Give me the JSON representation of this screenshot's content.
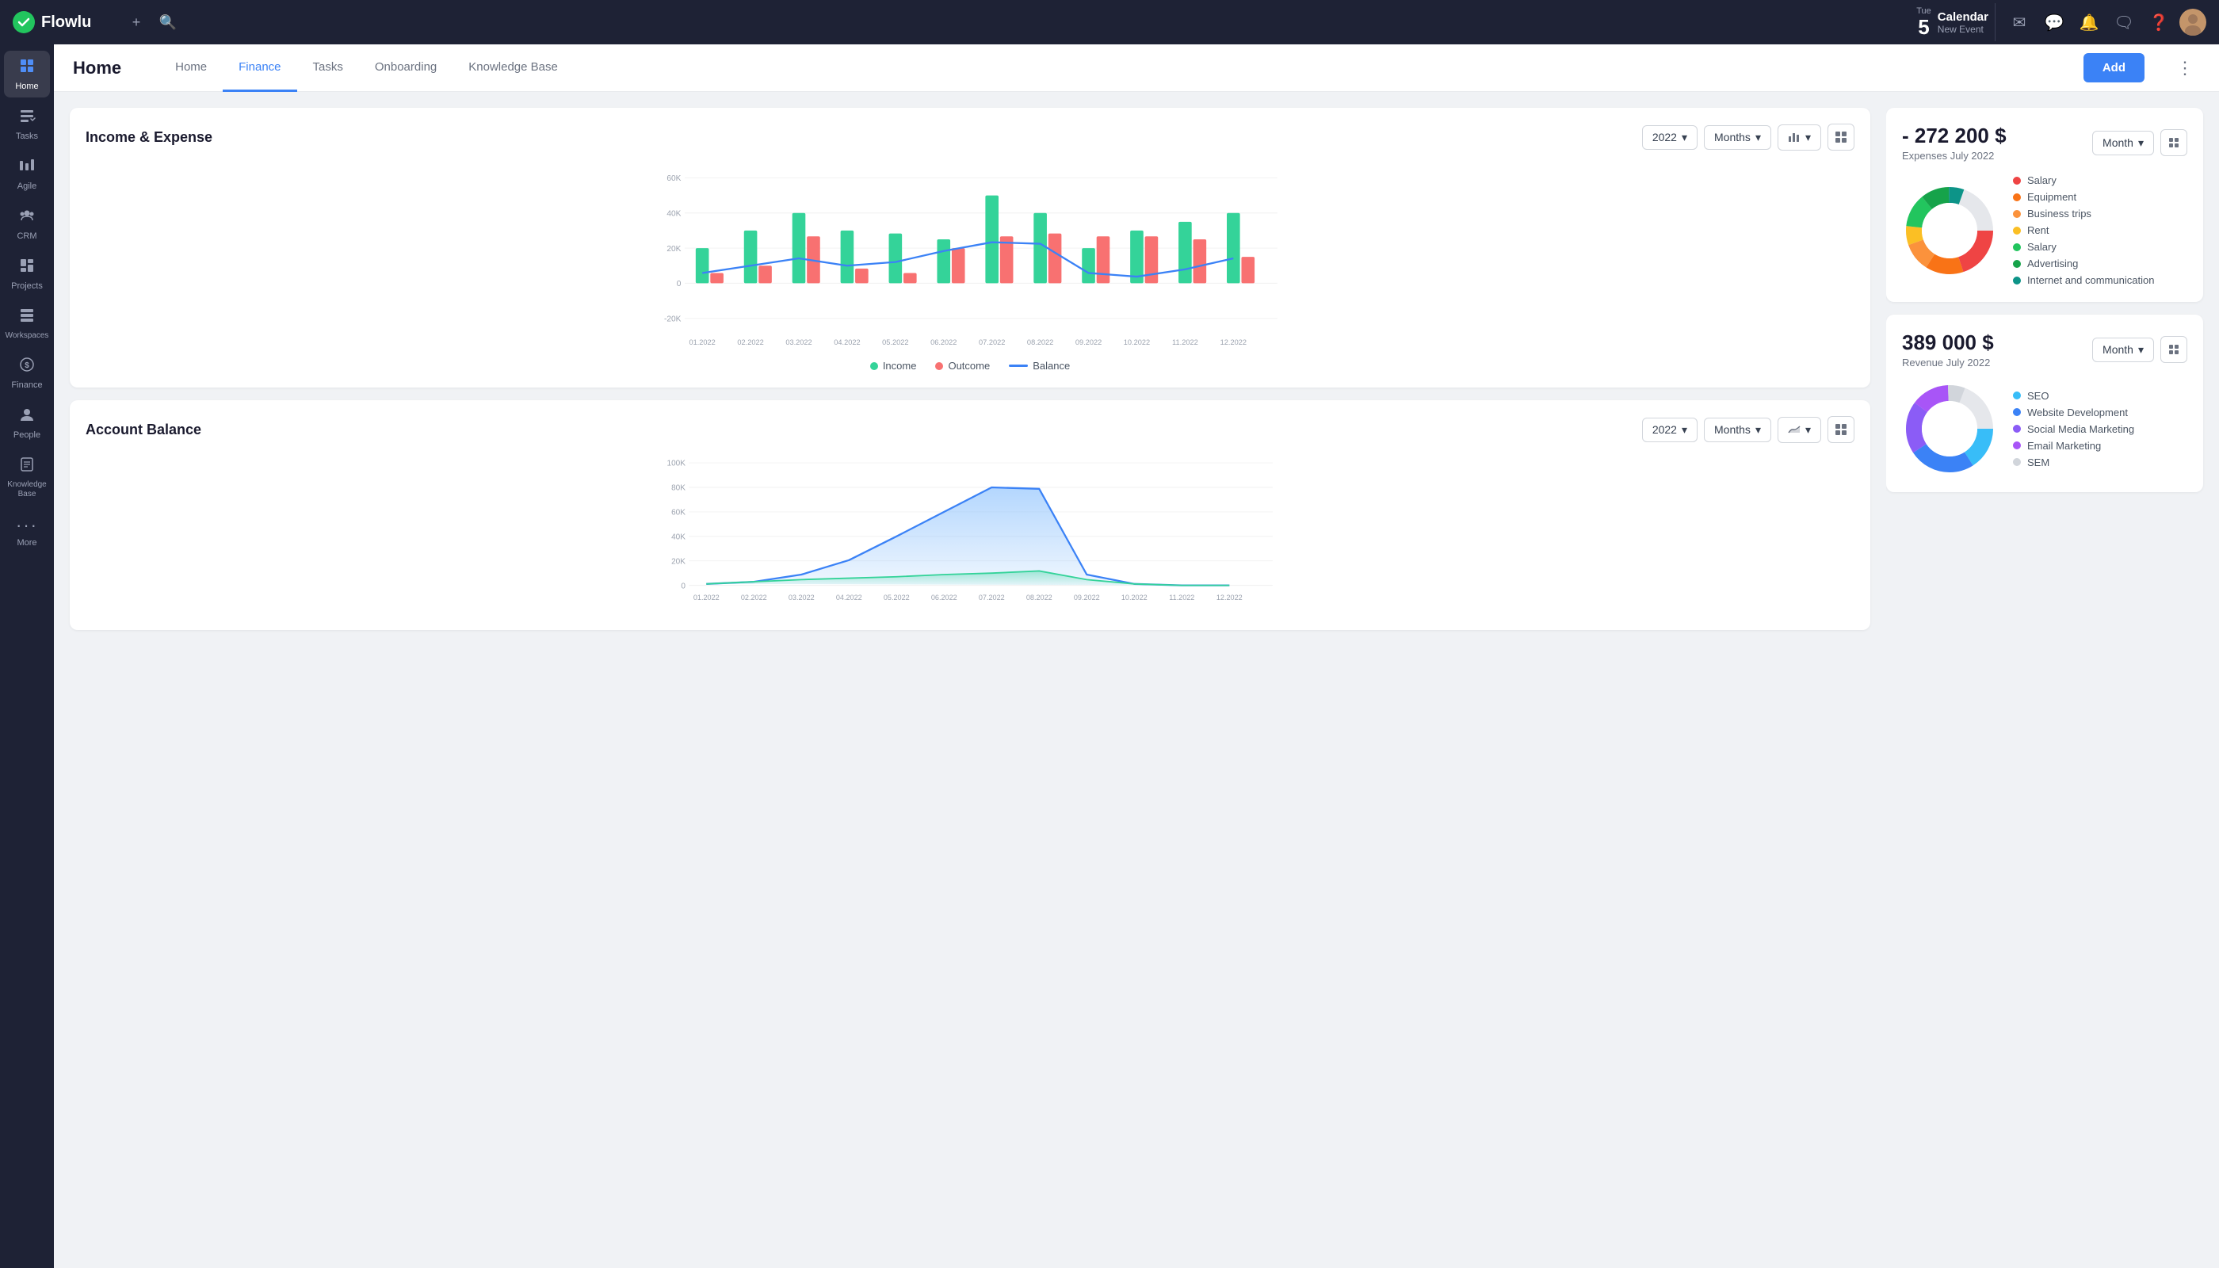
{
  "app": {
    "name": "Flowlu"
  },
  "topnav": {
    "calendar_day": "Tue",
    "calendar_num": "5",
    "calendar_title": "Calendar",
    "calendar_sub": "New Event",
    "add_plus": "+",
    "search_icon": "🔍"
  },
  "sidebar": {
    "items": [
      {
        "id": "home",
        "label": "Home",
        "icon": "⊞",
        "active": true
      },
      {
        "id": "tasks",
        "label": "Tasks",
        "icon": "✓",
        "active": false
      },
      {
        "id": "agile",
        "label": "Agile",
        "icon": "◈",
        "active": false
      },
      {
        "id": "crm",
        "label": "CRM",
        "icon": "👥",
        "active": false
      },
      {
        "id": "projects",
        "label": "Projects",
        "icon": "📁",
        "active": false
      },
      {
        "id": "workspaces",
        "label": "Workspaces",
        "icon": "⊟",
        "active": false
      },
      {
        "id": "finance",
        "label": "Finance",
        "icon": "💰",
        "active": false
      },
      {
        "id": "people",
        "label": "People",
        "icon": "👤",
        "active": false
      },
      {
        "id": "knowledge",
        "label": "Knowledge Base",
        "icon": "📖",
        "active": false
      },
      {
        "id": "more",
        "label": "More",
        "icon": "⋯",
        "active": false
      }
    ]
  },
  "page": {
    "title": "Home",
    "tabs": [
      "Home",
      "Finance",
      "Tasks",
      "Onboarding",
      "Knowledge Base"
    ],
    "active_tab": "Finance",
    "add_label": "Add"
  },
  "income_expense": {
    "title": "Income & Expense",
    "year": "2022",
    "period": "Months",
    "legend": [
      {
        "label": "Income",
        "color": "#34d399"
      },
      {
        "label": "Outcome",
        "color": "#f87171"
      },
      {
        "label": "Balance",
        "color": "#3b82f6"
      }
    ],
    "x_labels": [
      "01.2022",
      "02.2022",
      "03.2022",
      "04.2022",
      "05.2022",
      "06.2022",
      "07.2022",
      "08.2022",
      "09.2022",
      "10.2022",
      "11.2022",
      "12.2022"
    ],
    "y_labels": [
      "60K",
      "40K",
      "20K",
      "0",
      "-20K"
    ]
  },
  "account_balance": {
    "title": "Account Balance",
    "year": "2022",
    "period": "Months",
    "x_labels": [
      "01.2022",
      "02.2022",
      "03.2022",
      "04.2022",
      "05.2022",
      "06.2022",
      "07.2022",
      "08.2022",
      "09.2022",
      "10.2022",
      "11.2022",
      "12.2022"
    ],
    "y_labels": [
      "100K",
      "80K",
      "60K",
      "40K",
      "20K",
      "0"
    ]
  },
  "expenses_card": {
    "value": "- 272 200 $",
    "label": "Expenses July 2022",
    "period": "Month",
    "legend": [
      {
        "label": "Salary",
        "color": "#ef4444"
      },
      {
        "label": "Equipment",
        "color": "#f97316"
      },
      {
        "label": "Business trips",
        "color": "#fb923c"
      },
      {
        "label": "Rent",
        "color": "#fbbf24"
      },
      {
        "label": "Salary",
        "color": "#22c55e"
      },
      {
        "label": "Advertising",
        "color": "#16a34a"
      },
      {
        "label": "Internet and communication",
        "color": "#0d9488"
      }
    ]
  },
  "revenue_card": {
    "value": "389 000 $",
    "label": "Revenue July 2022",
    "period": "Month",
    "legend": [
      {
        "label": "SEO",
        "color": "#38bdf8"
      },
      {
        "label": "Website Development",
        "color": "#3b82f6"
      },
      {
        "label": "Social Media Marketing",
        "color": "#8b5cf6"
      },
      {
        "label": "Email Marketing",
        "color": "#a855f7"
      },
      {
        "label": "SEM",
        "color": "#d1d5db"
      }
    ]
  }
}
